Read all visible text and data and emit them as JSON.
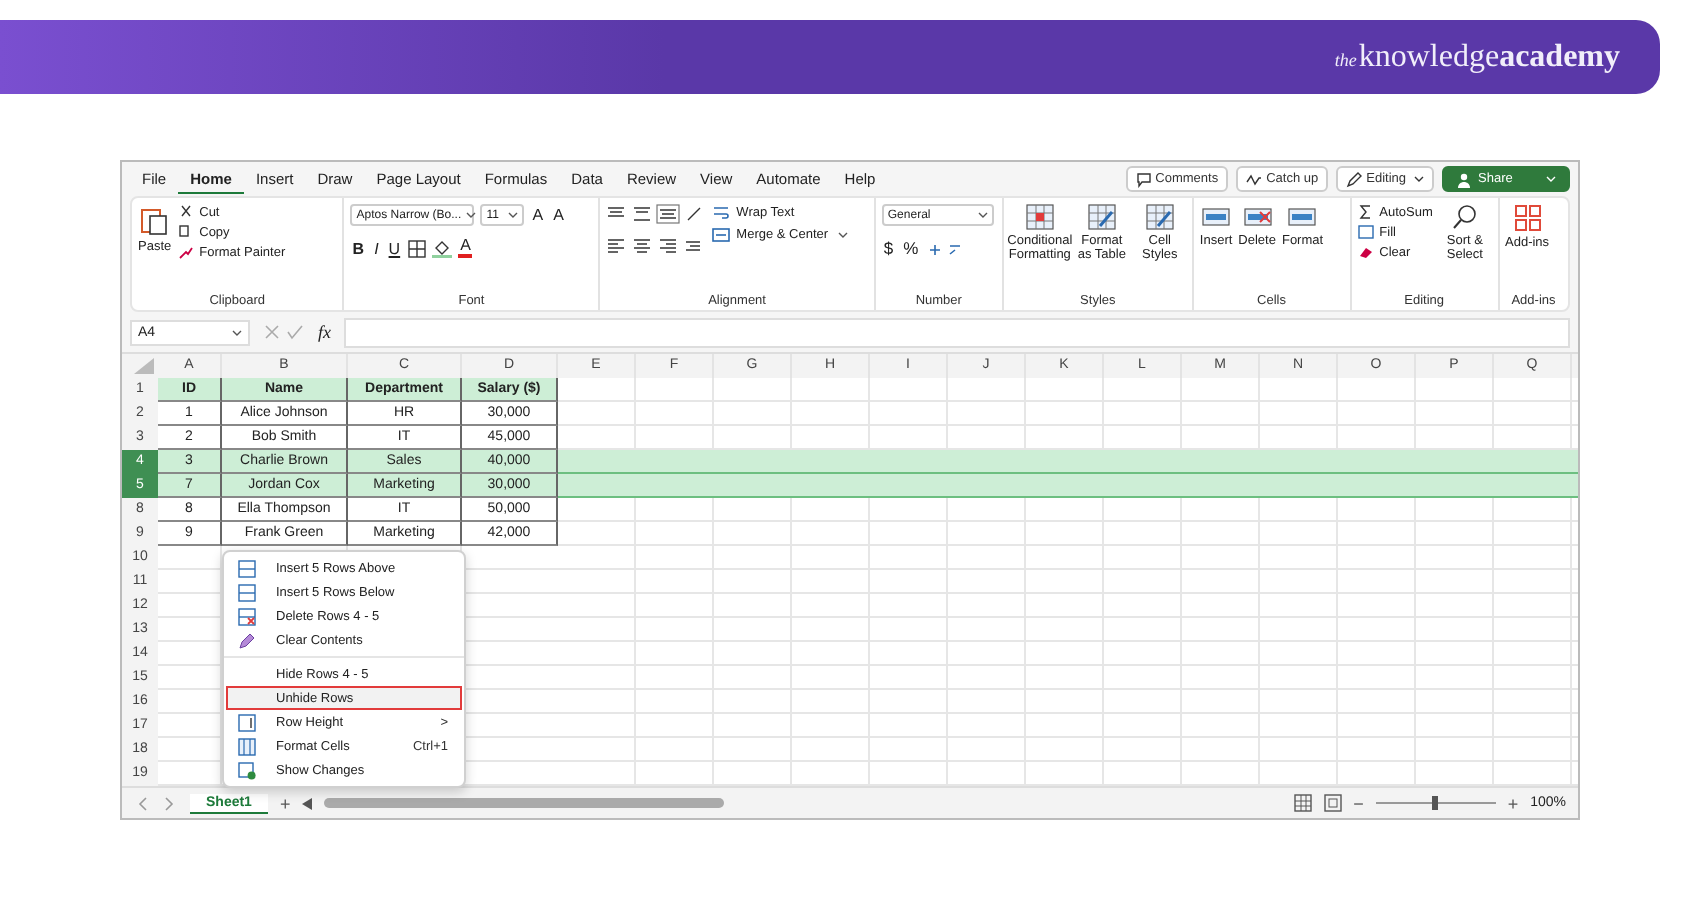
{
  "banner": {
    "logo": {
      "prefix": "the",
      "first": "knowledge",
      "second": "academy"
    }
  },
  "menu_tabs": [
    {
      "label": "File",
      "selected": false
    },
    {
      "label": "Home",
      "selected": true
    },
    {
      "label": "Insert",
      "selected": false
    },
    {
      "label": "Draw",
      "selected": false
    },
    {
      "label": "Page Layout",
      "selected": false
    },
    {
      "label": "Formulas",
      "selected": false
    },
    {
      "label": "Data",
      "selected": false
    },
    {
      "label": "Review",
      "selected": false
    },
    {
      "label": "View",
      "selected": false
    },
    {
      "label": "Automate",
      "selected": false
    },
    {
      "label": "Help",
      "selected": false
    }
  ],
  "header_buttons": [
    {
      "label": "Comments",
      "kind": "comments"
    },
    {
      "label": "Catch up",
      "kind": "catchup"
    },
    {
      "label": "Editing",
      "kind": "mode"
    },
    {
      "label": "Share",
      "kind": "share"
    }
  ],
  "ribbon": {
    "clipboard": {
      "label": "Clipboard",
      "paste": "Paste",
      "actions": [
        "Cut",
        "Copy",
        "Format Painter"
      ]
    },
    "font": {
      "label": "Font",
      "font_name": "Aptos Narrow (Bo...",
      "font_size": "11",
      "size_buttons": [
        "A",
        "A"
      ],
      "style_buttons": [
        "B",
        "I",
        "U"
      ],
      "color_button": "A"
    },
    "alignment": {
      "label": "Alignment",
      "wrap": "Wrap Text",
      "merge": "Merge & Center"
    },
    "number": {
      "label": "Number",
      "format": "General",
      "symbols": [
        "$",
        "%"
      ]
    },
    "styles": {
      "label": "Styles",
      "buttons": [
        "Conditional Formatting",
        "Format as Table",
        "Cell Styles"
      ]
    },
    "cells": {
      "label": "Cells",
      "buttons": [
        "Insert",
        "Delete",
        "Format"
      ]
    },
    "editing": {
      "label": "Editing",
      "actions": [
        "AutoSum",
        "Fill",
        "Clear"
      ],
      "sort": "Sort & Select"
    },
    "addins": {
      "label": "Add-ins",
      "button": "Add-ins"
    }
  },
  "formula_bar": {
    "name_box": "A4",
    "fx": "fx"
  },
  "grid": {
    "columns": [
      "A",
      "B",
      "C",
      "D",
      "E",
      "F",
      "G",
      "H",
      "I",
      "J",
      "K",
      "L",
      "M",
      "N",
      "O",
      "P",
      "Q"
    ],
    "rows": [
      {
        "number": "1",
        "selected": false,
        "kind": "header",
        "cells": [
          "ID",
          "Name",
          "Department",
          "Salary ($)"
        ]
      },
      {
        "number": "2",
        "selected": false,
        "kind": "data",
        "cells": [
          "1",
          "Alice Johnson",
          "HR",
          "30,000"
        ]
      },
      {
        "number": "3",
        "selected": false,
        "kind": "data",
        "cells": [
          "2",
          "Bob Smith",
          "IT",
          "45,000"
        ]
      },
      {
        "number": "4",
        "selected": true,
        "kind": "data",
        "cells": [
          "3",
          "Charlie Brown",
          "Sales",
          "40,000"
        ]
      },
      {
        "number": "5",
        "selected": true,
        "kind": "data",
        "cells": [
          "7",
          "Jordan Cox",
          "Marketing",
          "30,000"
        ]
      },
      {
        "number": "8",
        "selected": false,
        "kind": "data",
        "cells": [
          "8",
          "Ella Thompson",
          "IT",
          "50,000"
        ]
      },
      {
        "number": "9",
        "selected": false,
        "kind": "data",
        "cells": [
          "9",
          "Frank Green",
          "Marketing",
          "42,000"
        ]
      },
      {
        "number": "10",
        "selected": false,
        "kind": "empty"
      },
      {
        "number": "11",
        "selected": false,
        "kind": "empty"
      },
      {
        "number": "12",
        "selected": false,
        "kind": "empty"
      },
      {
        "number": "13",
        "selected": false,
        "kind": "empty"
      },
      {
        "number": "14",
        "selected": false,
        "kind": "empty"
      },
      {
        "number": "15",
        "selected": false,
        "kind": "empty"
      },
      {
        "number": "16",
        "selected": false,
        "kind": "empty"
      },
      {
        "number": "17",
        "selected": false,
        "kind": "empty"
      },
      {
        "number": "18",
        "selected": false,
        "kind": "empty"
      },
      {
        "number": "19",
        "selected": false,
        "kind": "empty"
      }
    ]
  },
  "context_menu": [
    {
      "label": "Insert 5 Rows Above",
      "selected": false
    },
    {
      "label": "Insert 5 Rows Below",
      "selected": false
    },
    {
      "label": "Delete Rows 4 - 5",
      "selected": false
    },
    {
      "label": "Clear Contents",
      "selected": false
    },
    {
      "label": "Hide Rows 4 - 5",
      "selected": false
    },
    {
      "label": "Unhide Rows",
      "selected": true
    },
    {
      "label": "Row Height",
      "selected": false,
      "trailing": ">"
    },
    {
      "label": "Format Cells",
      "selected": false,
      "trailing": "Ctrl+1"
    },
    {
      "label": "Show Changes",
      "selected": false
    }
  ],
  "sheet_bar": {
    "tabs": [
      {
        "label": "Sheet1",
        "selected": true
      }
    ],
    "add": "+",
    "zoom_out": "−",
    "zoom_in": "+",
    "zoom": {
      "level": 0.5,
      "reading": "100%"
    }
  }
}
